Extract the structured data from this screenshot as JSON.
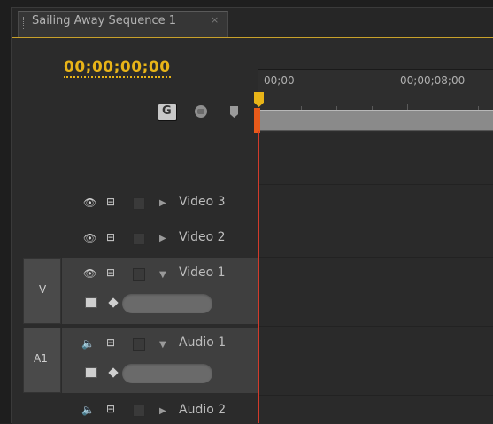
{
  "sequence_tab": {
    "title": "Sailing Away Sequence 1",
    "close_glyph": "×"
  },
  "timecode": {
    "current": "00;00;00;00",
    "color": "#e8b418"
  },
  "toolbar": {
    "snap_icon": "snap-icon",
    "snap_glyph": "G",
    "marker_icon": "add-marker-icon",
    "flag_icon": "set-sequence-marker-icon"
  },
  "ruler": {
    "labels": [
      "00;00",
      "00;00;08;00"
    ]
  },
  "playhead": {
    "head_color": "#e8b418",
    "line_color": "#d23b2b"
  },
  "tracks": {
    "video3": {
      "name": "Video 3",
      "expanded": false
    },
    "video2": {
      "name": "Video 2",
      "expanded": false
    },
    "video1": {
      "name": "Video 1",
      "expanded": true,
      "target_label": "V"
    },
    "audio1": {
      "name": "Audio 1",
      "expanded": true,
      "target_label": "A1"
    },
    "audio2": {
      "name": "Audio 2",
      "expanded": false
    }
  },
  "glyphs": {
    "eye": "👁",
    "film": "⊟",
    "speaker": "🔈",
    "collapsed": "▶",
    "expanded": "▼"
  }
}
